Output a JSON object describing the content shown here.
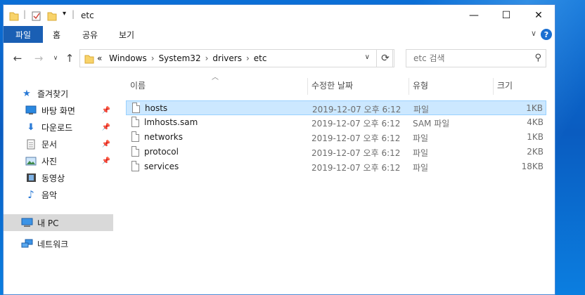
{
  "window": {
    "title": "etc",
    "minimize_glyph": "—",
    "maximize_glyph": "☐",
    "close_glyph": "✕"
  },
  "ribbon": {
    "tabs": [
      "파일",
      "홈",
      "공유",
      "보기"
    ],
    "help_glyph": "?"
  },
  "address": {
    "crumbs": [
      "«",
      "Windows",
      "System32",
      "drivers",
      "etc"
    ],
    "search_placeholder": "etc 검색"
  },
  "sidebar": {
    "items": [
      {
        "label": "즐겨찾기",
        "icon": "star-icon",
        "pinned": false
      },
      {
        "label": "바탕 화면",
        "icon": "desktop-icon",
        "pinned": true
      },
      {
        "label": "다운로드",
        "icon": "download-icon",
        "pinned": true
      },
      {
        "label": "문서",
        "icon": "document-icon",
        "pinned": true
      },
      {
        "label": "사진",
        "icon": "picture-icon",
        "pinned": true
      },
      {
        "label": "동영상",
        "icon": "video-icon",
        "pinned": false
      },
      {
        "label": "음악",
        "icon": "music-icon",
        "pinned": false
      },
      {
        "label": "내 PC",
        "icon": "computer-icon",
        "pinned": false,
        "selected": true
      },
      {
        "label": "네트워크",
        "icon": "network-icon",
        "pinned": false
      }
    ]
  },
  "columns": [
    "이름",
    "수정한 날짜",
    "유형",
    "크기"
  ],
  "files": [
    {
      "name": "hosts",
      "date": "2019-12-07 오후 6:12",
      "type": "파일",
      "size": "1KB",
      "selected": true
    },
    {
      "name": "lmhosts.sam",
      "date": "2019-12-07 오후 6:12",
      "type": "SAM 파일",
      "size": "4KB"
    },
    {
      "name": "networks",
      "date": "2019-12-07 오후 6:12",
      "type": "파일",
      "size": "1KB"
    },
    {
      "name": "protocol",
      "date": "2019-12-07 오후 6:12",
      "type": "파일",
      "size": "2KB"
    },
    {
      "name": "services",
      "date": "2019-12-07 오후 6:12",
      "type": "파일",
      "size": "18KB"
    }
  ],
  "colors": {
    "file_tab": "#1a5fb4",
    "selection": "#cce8ff",
    "selection_border": "#99d1ff",
    "desktop": "#0a64c8"
  }
}
